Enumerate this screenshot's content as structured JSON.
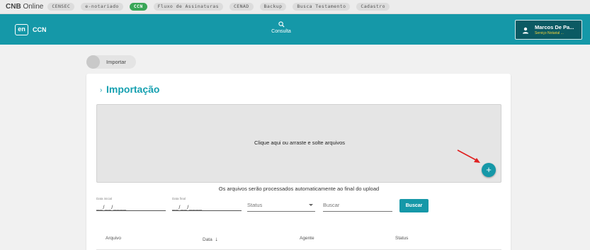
{
  "sysbar": {
    "brand_bold": "CNB",
    "brand_rest": " Online",
    "tabs": [
      {
        "label": "CENSEC",
        "active": false
      },
      {
        "label": "e-notariado",
        "active": false
      },
      {
        "label": "CCN",
        "active": true
      },
      {
        "label": "Fluxo de Assinaturas",
        "active": false
      },
      {
        "label": "CENAD",
        "active": false
      },
      {
        "label": "Backup",
        "active": false
      },
      {
        "label": "Busca Testamento",
        "active": false
      },
      {
        "label": "Cadastro",
        "active": false
      }
    ]
  },
  "appbar": {
    "logo_text": "en",
    "app_name": "CCN",
    "nav": {
      "label": "Consulta",
      "icon": "search-icon"
    },
    "user": {
      "name": "Marcos De Pa...",
      "office": "Serviço Notarial ..."
    }
  },
  "breadcrumb": {
    "label": "Importar"
  },
  "import": {
    "title": "Importação",
    "dropzone_text": "Clique aqui ou arraste e solte arquivos",
    "hint": "Os arquivos serão processados automaticamente ao final do upload"
  },
  "filters": {
    "date_start_label": "Data inicial",
    "date_start_value": "__/__/____",
    "date_end_label": "Data final",
    "date_end_value": "__/__/____",
    "status_placeholder": "Status",
    "search_placeholder": "Buscar",
    "search_button": "Buscar"
  },
  "table": {
    "columns": [
      "Arquivo",
      "Data",
      "Agente",
      "Status"
    ],
    "sort_indicator": "↓"
  },
  "colors": {
    "brand": "#1598a8",
    "active_tab": "#3aa657",
    "user_box": "#0b5a63",
    "user_sub": "#f2d43a",
    "arrow": "#e02020"
  }
}
